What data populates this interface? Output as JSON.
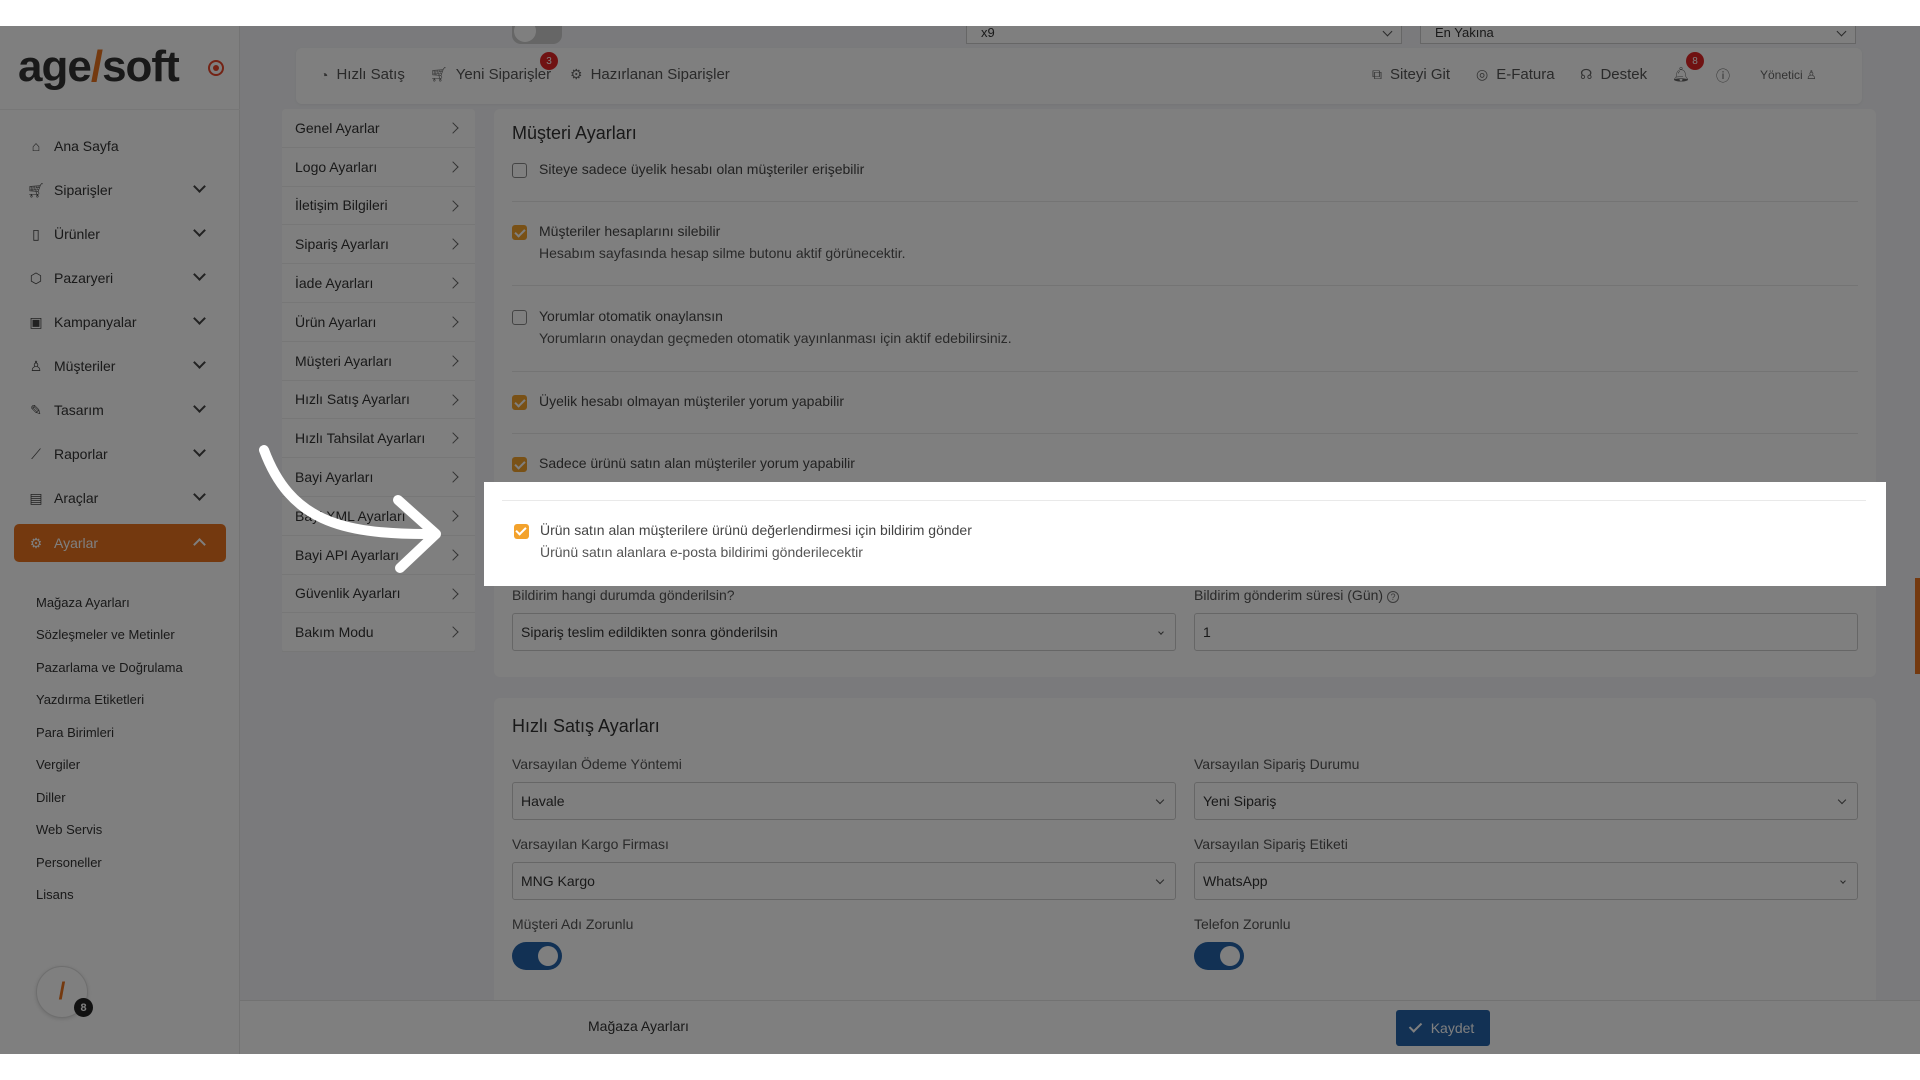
{
  "brand": {
    "logo_text_a": "age",
    "logo_slash": "/",
    "logo_text_b": "soft",
    "tagline": ""
  },
  "strip": {
    "select_1": "x9",
    "select_2": "En Yakına"
  },
  "topbar": {
    "items": [
      {
        "label": "Hızlı Satış",
        "icon": "speedometer-icon"
      },
      {
        "label": "Yeni Siparişler",
        "icon": "cart-icon",
        "badge": "3"
      },
      {
        "label": "Hazırlanan Siparişler",
        "icon": "gear-box-icon"
      }
    ],
    "right_items": [
      {
        "label": "Siteyi Git",
        "icon": "external-icon"
      },
      {
        "label": "E-Fatura",
        "icon": "invoice-icon"
      },
      {
        "label": "Destek",
        "icon": "headset-icon"
      }
    ],
    "notification_badge": "8",
    "user_label": "Yönetici"
  },
  "sidebar": {
    "items": [
      {
        "label": "Ana Sayfa",
        "icon": "home-icon",
        "expandable": false
      },
      {
        "label": "Siparişler",
        "icon": "cart-icon",
        "expandable": true
      },
      {
        "label": "Ürünler",
        "icon": "book-icon",
        "expandable": true
      },
      {
        "label": "Pazaryeri",
        "icon": "box-icon",
        "expandable": true
      },
      {
        "label": "Kampanyalar",
        "icon": "gift-icon",
        "expandable": true
      },
      {
        "label": "Müşteriler",
        "icon": "user-icon",
        "expandable": true
      },
      {
        "label": "Tasarım",
        "icon": "edit-icon",
        "expandable": true
      },
      {
        "label": "Raporlar",
        "icon": "chart-icon",
        "expandable": true
      },
      {
        "label": "Araçlar",
        "icon": "clipboard-icon",
        "expandable": true
      },
      {
        "label": "Ayarlar",
        "icon": "gear-icon",
        "expandable": true,
        "active": true
      }
    ],
    "sub_items": [
      "Mağaza Ayarları",
      "Sözleşmeler ve Metinler",
      "Pazarlama ve Doğrulama",
      "Yazdırma Etiketleri",
      "Para Birimleri",
      "Vergiler",
      "Diller",
      "Web Servis",
      "Personeller",
      "Lisans"
    ],
    "avatar_glyph": "/",
    "avatar_badge": "8"
  },
  "settings_menu": [
    "Genel Ayarlar",
    "Logo Ayarları",
    "İletişim Bilgileri",
    "Sipariş Ayarları",
    "İade Ayarları",
    "Ürün Ayarları",
    "Müşteri Ayarları",
    "Hızlı Satış Ayarları",
    "Hızlı Tahsilat Ayarları",
    "Bayi Ayarları",
    "Bayi XML Ayarları",
    "Bayi API Ayarları",
    "Güvenlik Ayarları",
    "Bakım Modu"
  ],
  "customer_settings": {
    "title": "Müşteri Ayarları",
    "options": [
      {
        "label": "Siteye sadece üyelik hesabı olan müşteriler erişebilir",
        "desc": "",
        "checked": false
      },
      {
        "label": "Müşteriler hesaplarını silebilir",
        "desc": "Hesabım sayfasında hesap silme butonu aktif görünecektir.",
        "checked": true
      },
      {
        "label": "Yorumlar otomatik onaylansın",
        "desc": "Yorumların onaydan geçmeden otomatik yayınlanması için aktif edebilirsiniz.",
        "checked": false
      },
      {
        "label": "Üyelik hesabı olmayan müşteriler yorum yapabilir",
        "desc": "",
        "checked": true
      },
      {
        "label": "Sadece ürünü satın alan müşteriler yorum yapabilir",
        "desc": "",
        "checked": true
      }
    ],
    "highlighted_option": {
      "label": "Ürün satın alan müşterilere ürünü değerlendirmesi için bildirim gönder",
      "desc": "Ürünü satın alanlara e-posta bildirimi gönderilecektir",
      "checked": true
    },
    "notify_when_label": "Bildirim hangi durumda gönderilsin?",
    "notify_when_value": "Sipariş teslim edildikten sonra gönderilsin",
    "notify_days_label": "Bildirim gönderim süresi (Gün)",
    "notify_days_value": "1"
  },
  "quick_sale_settings": {
    "title": "Hızlı Satış Ayarları",
    "payment_label": "Varsayılan Ödeme Yöntemi",
    "payment_value": "Havale",
    "order_status_label": "Varsayılan Sipariş Durumu",
    "order_status_value": "Yeni Sipariş",
    "cargo_label": "Varsayılan Kargo Firması",
    "cargo_value": "MNG Kargo",
    "order_tag_label": "Varsayılan Sipariş Etiketi",
    "order_tag_value": "WhatsApp",
    "customer_name_required_label": "Müşteri Adı Zorunlu",
    "customer_name_required": true,
    "phone_required_label": "Telefon Zorunlu",
    "phone_required": true
  },
  "bottombar": {
    "label": "Mağaza Ayarları",
    "save_label": "Kaydet"
  },
  "colors": {
    "accent": "#e8731f",
    "primary": "#2563a8",
    "checkbox": "#f3a22c",
    "badge": "#e02424"
  }
}
